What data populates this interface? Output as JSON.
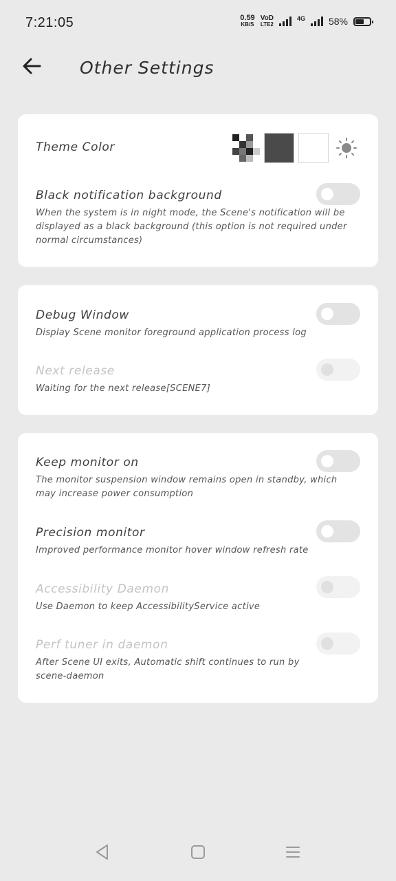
{
  "status_bar": {
    "time": "7:21:05",
    "net_speed_value": "0.59",
    "net_speed_unit": "KB/S",
    "volte_top": "VoD",
    "volte_bottom": "LTE2",
    "network_type": "4G",
    "battery_percent": "58%",
    "battery_level": 0.58
  },
  "header": {
    "back_icon": "arrow-left-icon",
    "title": "Other Settings"
  },
  "card1": {
    "theme": {
      "label": "Theme Color",
      "options": [
        "checker-pattern",
        "dark",
        "light",
        "auto-brightness-icon"
      ]
    },
    "black_notification": {
      "title": "Black notification background",
      "desc": "When the system is in night mode, the Scene's notification will be displayed as a black background (this option is not required under normal circumstances)",
      "enabled": false
    }
  },
  "card2": {
    "debug_window": {
      "title": "Debug Window",
      "desc": "Display Scene monitor foreground application process log",
      "enabled": false
    },
    "next_release": {
      "title": "Next release",
      "desc": "Waiting for the next release[SCENE7]",
      "enabled": false,
      "disabled": true
    }
  },
  "card3": {
    "keep_monitor": {
      "title": "Keep monitor on",
      "desc": "The monitor suspension window remains open in standby, which may increase power consumption",
      "enabled": false
    },
    "precision_monitor": {
      "title": "Precision monitor",
      "desc": "Improved performance monitor hover window refresh rate",
      "enabled": false
    },
    "accessibility_daemon": {
      "title": "Accessibility Daemon",
      "desc": "Use Daemon to keep AccessibilityService active",
      "enabled": false,
      "disabled": true
    },
    "perf_tuner": {
      "title": "Perf tuner in daemon",
      "desc": "After Scene UI exits, Automatic shift continues to run by scene-daemon",
      "enabled": false,
      "disabled": true
    }
  },
  "nav_bar": {
    "back": "triangle-back-icon",
    "home": "square-home-icon",
    "recents": "menu-lines-icon"
  },
  "colors": {
    "background": "#eaeaea",
    "card": "#ffffff",
    "toggle_off": "#e3e3e3",
    "text": "#3f3f3f",
    "disabled_text": "#c4c4c4"
  }
}
